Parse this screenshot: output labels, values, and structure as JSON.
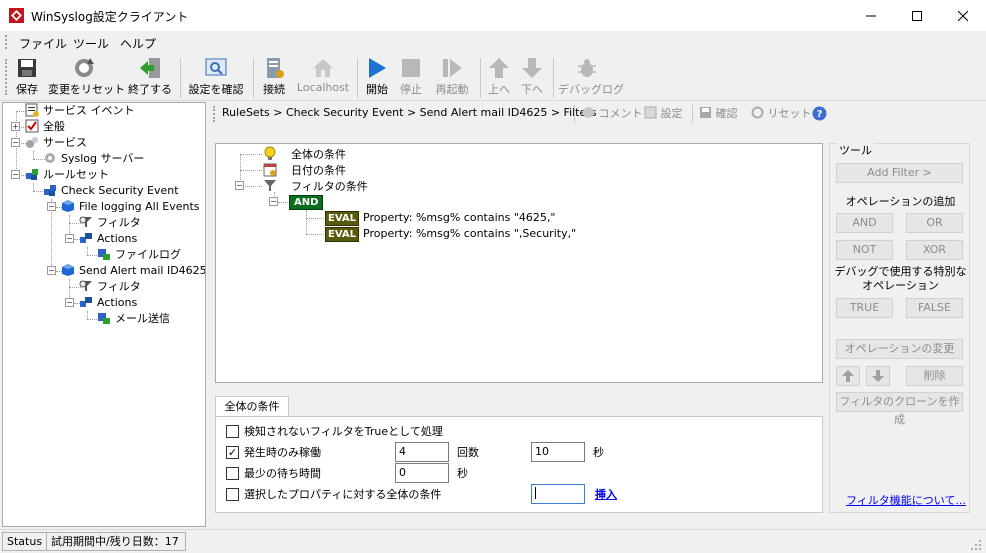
{
  "window": {
    "title": "WinSyslog設定クライアント",
    "controls": {
      "minimize": "—",
      "maximize": "☐",
      "close": "✕"
    }
  },
  "menu": [
    "ファイル",
    "ツール",
    "ヘルプ"
  ],
  "toolbar": [
    {
      "label": "保存",
      "icon": "save-icon",
      "enabled": true
    },
    {
      "label": "変更をリセット",
      "icon": "reset-icon",
      "enabled": true
    },
    {
      "label": "終了する",
      "icon": "exit-icon",
      "enabled": true
    },
    {
      "label": "設定を確認",
      "icon": "verify-icon",
      "enabled": true
    },
    {
      "label": "接続",
      "icon": "connect-icon",
      "enabled": true
    },
    {
      "label": "Localhost",
      "icon": "home-icon",
      "enabled": false
    },
    {
      "label": "開始",
      "icon": "play-icon",
      "enabled": true
    },
    {
      "label": "停止",
      "icon": "stop-icon",
      "enabled": false
    },
    {
      "label": "再起動",
      "icon": "restart-icon",
      "enabled": false
    },
    {
      "label": "上へ",
      "icon": "arrow-up-icon",
      "enabled": false
    },
    {
      "label": "下へ",
      "icon": "arrow-down-icon",
      "enabled": false
    },
    {
      "label": "デバッグログ",
      "icon": "bug-icon",
      "enabled": false
    }
  ],
  "tree": [
    {
      "label": "サービス イベント",
      "icon": "service-event-icon"
    },
    {
      "label": "全般",
      "icon": "general-icon"
    },
    {
      "label": "サービス",
      "icon": "services-icon"
    },
    {
      "label": "Syslog サーバー",
      "icon": "gear-icon"
    },
    {
      "label": "ルールセット",
      "icon": "ruleset-icon"
    },
    {
      "label": "Check Security Event",
      "icon": "ruleset-icon"
    },
    {
      "label": "File logging All Events",
      "icon": "rule-cube-icon"
    },
    {
      "label": "フィルタ",
      "icon": "filter-icon"
    },
    {
      "label": "Actions",
      "icon": "actions-icon"
    },
    {
      "label": "ファイルログ",
      "icon": "action-item-icon"
    },
    {
      "label": "Send Alert mail ID4625",
      "icon": "rule-cube-icon"
    },
    {
      "label": "フィルタ",
      "icon": "filter-icon"
    },
    {
      "label": "Actions",
      "icon": "actions-icon"
    },
    {
      "label": "メール送信",
      "icon": "action-item-icon"
    }
  ],
  "breadcrumb": {
    "path": "RuleSets > Check Security Event > Send Alert mail ID4625 > Filters",
    "tools": [
      "コメント",
      "設定",
      "確認",
      "リセット"
    ]
  },
  "filter_tree": {
    "global": "全体の条件",
    "date": "日付の条件",
    "filters": "フィルタの条件",
    "operator": "AND",
    "eval_tag": "EVAL",
    "conditions": [
      "Property: %msg% contains \"4625,\"",
      "Property: %msg% contains \",Security,\""
    ]
  },
  "bottom": {
    "tab": "全体の条件",
    "options": [
      {
        "label": "検知されないフィルタをTrueとして処理",
        "checked": false
      },
      {
        "label": "発生時のみ稼働",
        "checked": true,
        "value1": "4",
        "unit1": "回数",
        "value2": "10",
        "unit2": "秒"
      },
      {
        "label": "最少の待ち時間",
        "checked": false,
        "value1": "0",
        "unit1": "秒"
      },
      {
        "label": "選択したプロパティに対する全体の条件",
        "checked": false,
        "value1": "",
        "link": "挿入"
      }
    ]
  },
  "tools_panel": {
    "title": "ツール",
    "add_filter": "Add Filter >",
    "add_operation": "オペレーションの追加",
    "and": "AND",
    "or": "OR",
    "not": "NOT",
    "xor": "XOR",
    "debug_ops": "デバッグで使用する特別なオペレーション",
    "true": "TRUE",
    "false": "FALSE",
    "change_op": "オペレーションの変更",
    "delete": "削除",
    "clone": "フィルタのクローンを作成",
    "about_link": "フィルタ機能について..."
  },
  "status": {
    "label": "Status",
    "trial": "試用期間中/残り日数：17"
  }
}
